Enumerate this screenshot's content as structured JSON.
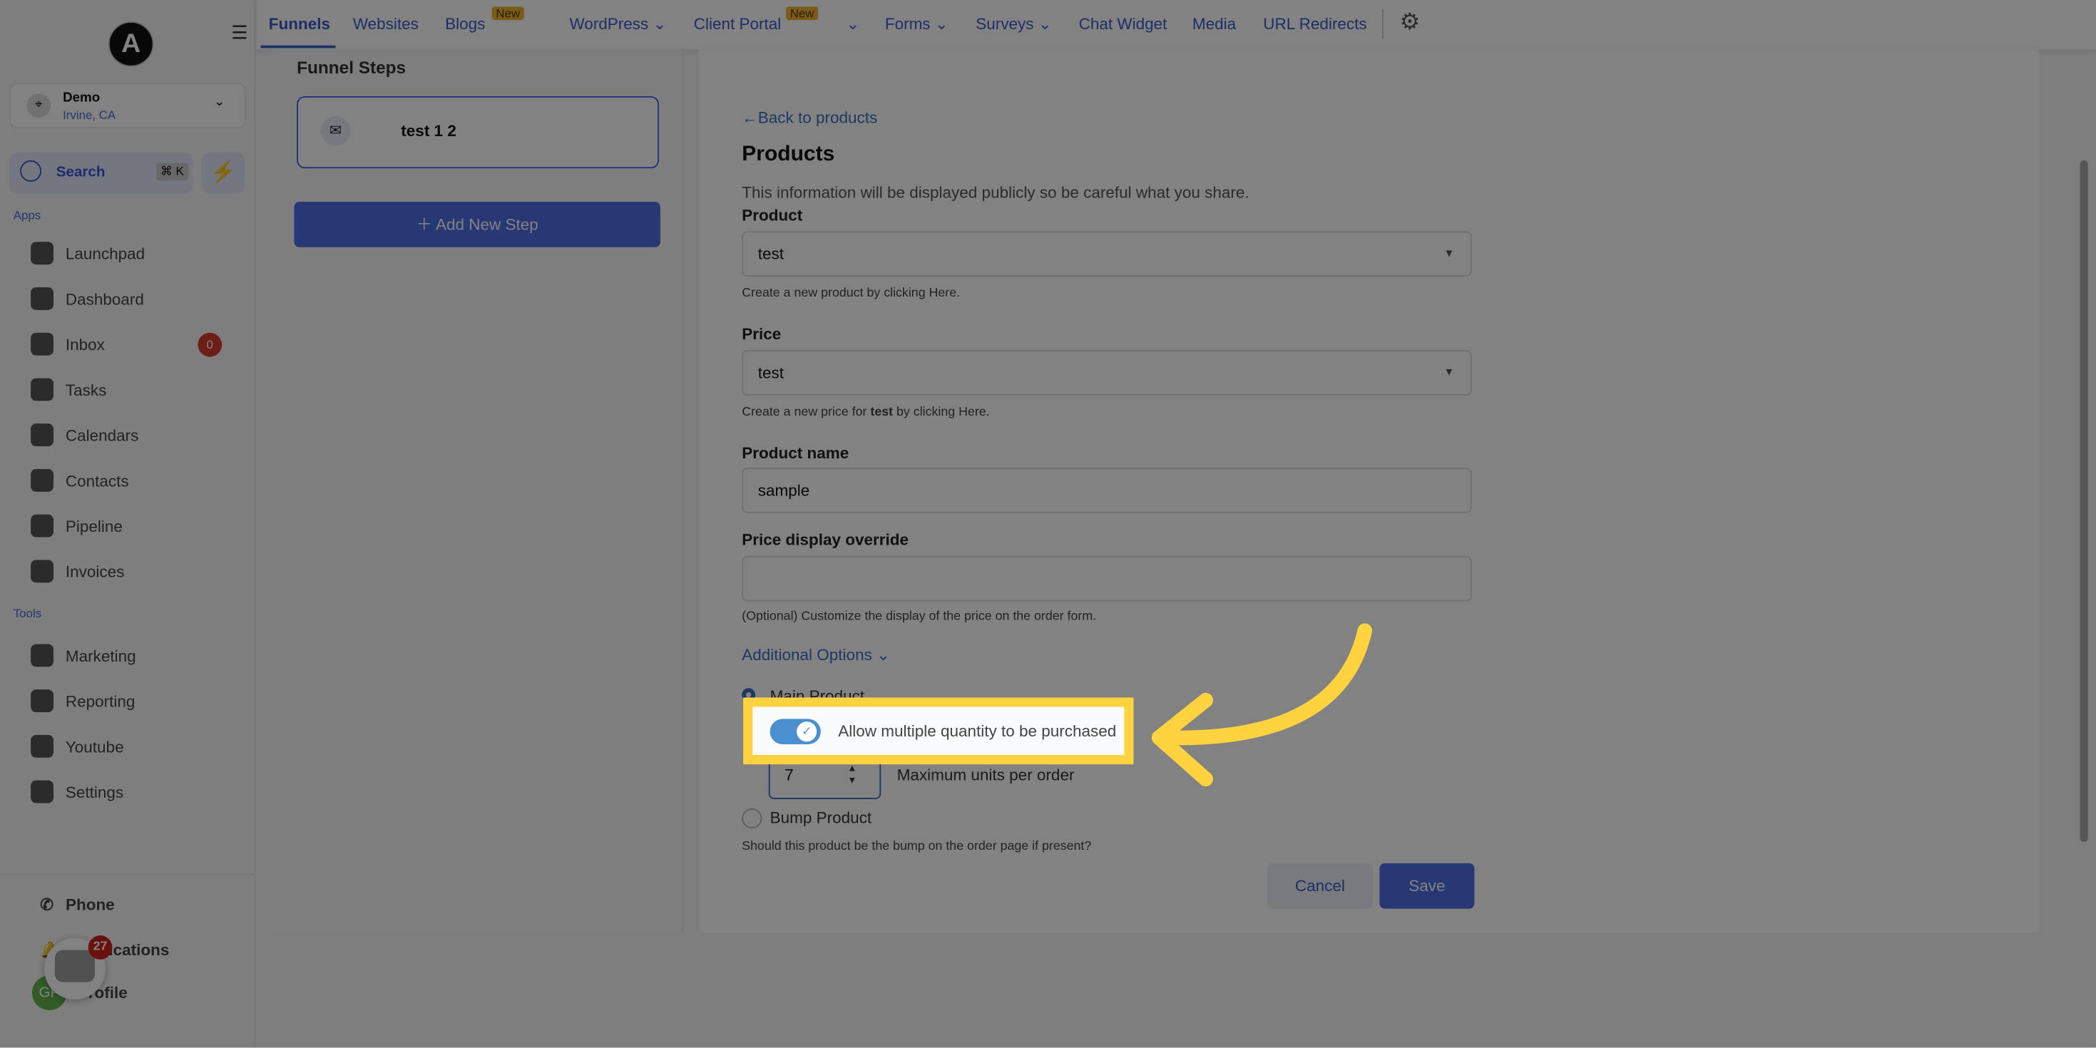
{
  "sidebar": {
    "logo": "A",
    "location": {
      "name": "Demo",
      "city": "Irvine, CA"
    },
    "search": {
      "label": "Search",
      "shortcut": "⌘ K"
    },
    "apps_label": "Apps",
    "apps": [
      {
        "label": "Launchpad"
      },
      {
        "label": "Dashboard"
      },
      {
        "label": "Inbox",
        "badge": "0"
      },
      {
        "label": "Tasks"
      },
      {
        "label": "Calendars"
      },
      {
        "label": "Contacts"
      },
      {
        "label": "Pipeline"
      },
      {
        "label": "Invoices"
      }
    ],
    "tools_label": "Tools",
    "tools": [
      {
        "label": "Marketing"
      },
      {
        "label": "Reporting"
      },
      {
        "label": "Youtube"
      },
      {
        "label": "Settings"
      }
    ],
    "bottom": [
      {
        "label": "Phone"
      },
      {
        "label": "Notifications"
      },
      {
        "label": "Profile"
      }
    ],
    "avatar": "GP",
    "chat_badge": "27"
  },
  "topnav": {
    "tabs": [
      {
        "label": "Funnels",
        "active": true
      },
      {
        "label": "Websites"
      },
      {
        "label": "Blogs",
        "badge": "New"
      },
      {
        "label": "WordPress"
      },
      {
        "label": "Client Portal",
        "badge": "New"
      },
      {
        "label": "Forms"
      },
      {
        "label": "Surveys"
      },
      {
        "label": "Chat Widget"
      },
      {
        "label": "Media"
      },
      {
        "label": "URL Redirects"
      }
    ]
  },
  "steps": {
    "title": "Funnel Steps",
    "items": [
      {
        "label": "test 1 2"
      }
    ],
    "add_label": "Add New Step"
  },
  "form": {
    "back": "Back to products",
    "title": "Products",
    "subtitle": "This information will be displayed publicly so be careful what you share.",
    "product_label": "Product",
    "product_value": "test",
    "product_hint": "Create a new product by clicking Here.",
    "price_label": "Price",
    "price_value": "test",
    "price_hint_pre": "Create a new price for ",
    "price_hint_bold": "test",
    "price_hint_post": " by clicking Here.",
    "name_label": "Product name",
    "name_value": "sample",
    "override_label": "Price display override",
    "override_value": "",
    "override_hint": "(Optional) Customize the display of the price on the order form.",
    "additional": "Additional Options",
    "main_product": "Main Product",
    "allow_multi": "Allow multiple quantity to be purchased",
    "allow_multi_on": true,
    "max_units_value": "7",
    "max_units_label": "Maximum units per order",
    "bump": "Bump Product",
    "bump_hint": "Should this product be the bump on the order page if present?",
    "cancel": "Cancel",
    "save": "Save"
  },
  "colors": {
    "accent": "#4263eb",
    "highlight": "#ffd23f",
    "toggle": "#4a90d0"
  }
}
